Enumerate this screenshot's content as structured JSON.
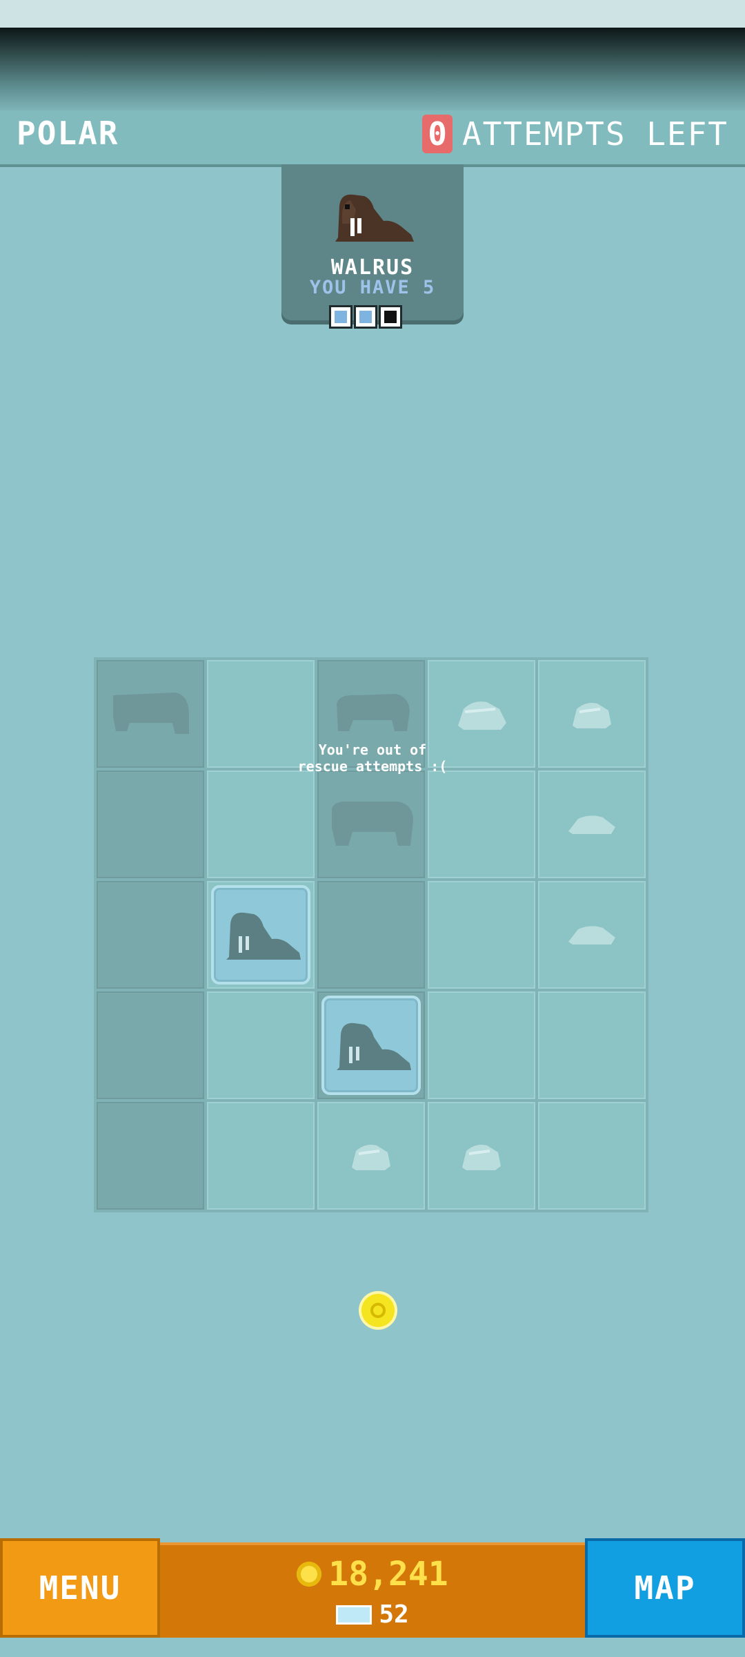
{
  "header": {
    "title": "POLAR",
    "attempts_count": "0",
    "attempts_label": "ATTEMPTS LEFT"
  },
  "animal_card": {
    "name": "WALRUS",
    "you_have": "YOU HAVE 5",
    "progress": [
      "filled",
      "filled",
      "empty"
    ],
    "icon": "walrus-icon"
  },
  "board": {
    "message_line1": "You're out of",
    "message_line2": "rescue attempts :(",
    "rows": 5,
    "cols": 5
  },
  "footer": {
    "menu_label": "MENU",
    "coins": "18,241",
    "gems": "52",
    "map_label": "MAP"
  },
  "colors": {
    "background": "#8fc5ca",
    "menu": "#f29a14",
    "map": "#119fe2",
    "wallet": "#d37808",
    "attempts_badge": "#e76b6b"
  }
}
